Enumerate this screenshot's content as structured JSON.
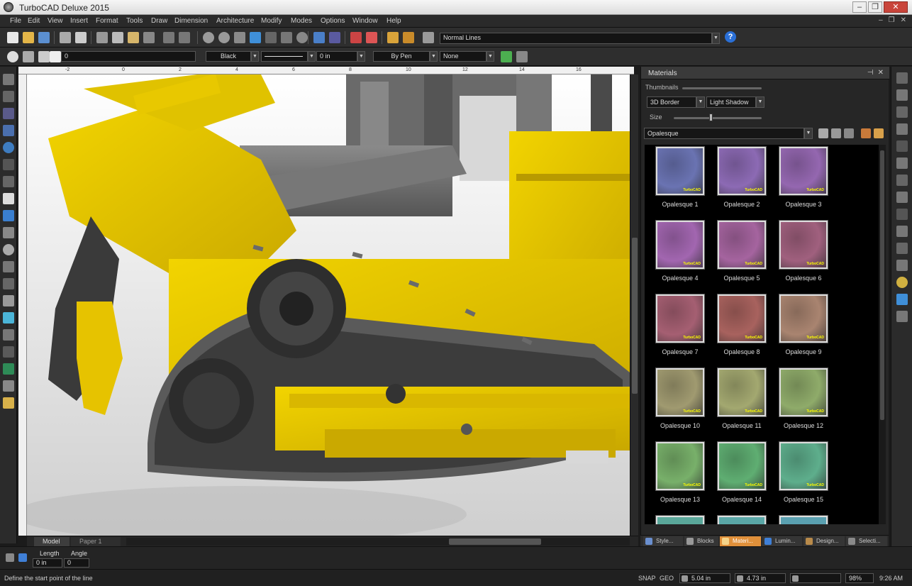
{
  "app": {
    "title": "TurboCAD Deluxe 2015"
  },
  "menu": [
    "File",
    "Edit",
    "View",
    "Insert",
    "Format",
    "Tools",
    "Draw",
    "Dimension",
    "Architecture",
    "Modify",
    "Modes",
    "Options",
    "Window",
    "Help"
  ],
  "toolbar1": {
    "line_style": "Normal Lines"
  },
  "toolbar2": {
    "layer_value": "0",
    "color": "Black",
    "width": "0 in",
    "linetype": "By Pen",
    "pattern": "None"
  },
  "viewport": {
    "tabs": [
      "Model",
      "Paper 1"
    ],
    "ruler_top": [
      "-2",
      "0",
      "2",
      "4",
      "6",
      "8",
      "10",
      "12",
      "14",
      "16",
      "18",
      "20",
      "22",
      "24",
      "26"
    ]
  },
  "panel": {
    "title": "Materials",
    "thumbnails_label": "Thumbnails",
    "border_value": "3D Border",
    "shadow_value": "Light Shadow",
    "size_label": "Size",
    "category_value": "Opalesque",
    "swatch_logo": "TurboCAD",
    "materials": [
      {
        "name": "Opalesque 1",
        "color": "#6a73b2"
      },
      {
        "name": "Opalesque 2",
        "color": "#8c6ab4"
      },
      {
        "name": "Opalesque 3",
        "color": "#9467b0"
      },
      {
        "name": "Opalesque 4",
        "color": "#a266b0"
      },
      {
        "name": "Opalesque 5",
        "color": "#a5649f"
      },
      {
        "name": "Opalesque 6",
        "color": "#a0607e"
      },
      {
        "name": "Opalesque 7",
        "color": "#a55f72"
      },
      {
        "name": "Opalesque 8",
        "color": "#a8625e"
      },
      {
        "name": "Opalesque 9",
        "color": "#a98470"
      },
      {
        "name": "Opalesque 10",
        "color": "#a09a70"
      },
      {
        "name": "Opalesque 11",
        "color": "#a3a870"
      },
      {
        "name": "Opalesque 12",
        "color": "#8fab6a"
      },
      {
        "name": "Opalesque 13",
        "color": "#78b06a"
      },
      {
        "name": "Opalesque 14",
        "color": "#5fae72"
      },
      {
        "name": "Opalesque 15",
        "color": "#5eae8c"
      }
    ],
    "tabs": [
      "Style...",
      "Blocks",
      "Materi...",
      "Lumin...",
      "Design...",
      "Selecti..."
    ]
  },
  "inspector": {
    "length_label": "Length",
    "angle_label": "Angle",
    "length_value": "0 in",
    "angle_value": "0"
  },
  "status": {
    "prompt": "Define the start point of the line",
    "snap": "SNAP",
    "geo": "GEO",
    "x": "5.04 in",
    "y": "4.73 in",
    "zoom": "98%",
    "time": "9:26 AM"
  }
}
